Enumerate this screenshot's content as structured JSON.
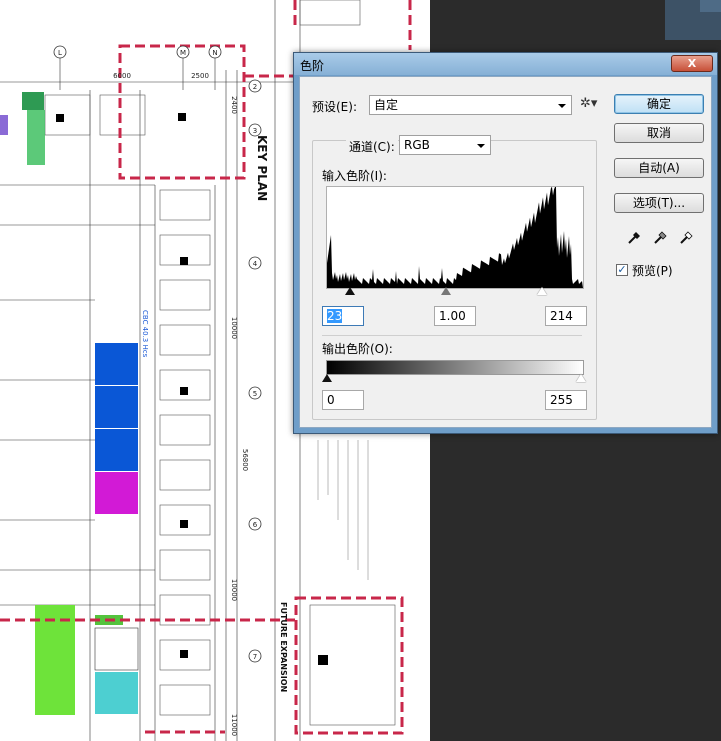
{
  "plan": {
    "left_dims": [
      "6000",
      "2500",
      "2400"
    ],
    "grid_circles": [
      "L",
      "M",
      "N"
    ],
    "row_circles": [
      "2",
      "3",
      "4",
      "5",
      "6",
      "7"
    ],
    "vertical_dims": [
      "10000",
      "56800",
      "10000",
      "11000"
    ],
    "key_plan": "KEY PLAN",
    "future_expansion": "FUTURE EXPANSION",
    "cbc_label": "CBC 40.3 Hcs"
  },
  "dialog": {
    "title": "色阶",
    "close_label": "X",
    "preset_label": "预设(E):",
    "preset_value": "自定",
    "channel_label": "通道(C):",
    "channel_value": "RGB",
    "input_levels_label": "输入色阶(I):",
    "output_levels_label": "输出色阶(O):",
    "input_black": "23",
    "input_gamma": "1.00",
    "input_white": "214",
    "output_black": "0",
    "output_white": "255",
    "buttons": {
      "ok": "确定",
      "cancel": "取消",
      "auto": "自动(A)",
      "options": "选项(T)..."
    },
    "preview_label": "预览(P)",
    "preview_checked": "✓",
    "gear_glyph": "✲▾"
  },
  "chart_data": {
    "type": "area",
    "title": "",
    "xlabel": "",
    "ylabel": "",
    "xlim": [
      0,
      255
    ],
    "ylim": [
      0,
      100
    ],
    "input_markers": [
      23,
      1.0,
      214
    ],
    "output_markers": [
      0,
      255
    ]
  }
}
